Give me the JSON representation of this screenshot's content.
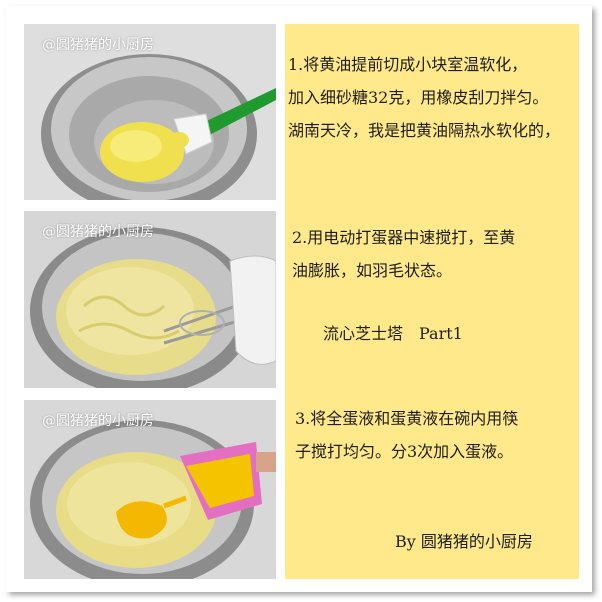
{
  "photos": [
    {
      "watermark": "@圆猪猪的小厨房"
    },
    {
      "watermark": "@圆猪猪的小厨房"
    },
    {
      "watermark": "@圆猪猪的小厨房"
    }
  ],
  "steps": [
    {
      "lines": [
        "1.将黄油提前切成小块室温软化，",
        "加入细砂糖32克，用橡皮刮刀拌匀。",
        "湖南天冷，我是把黄油隔热水软化的，"
      ]
    },
    {
      "lines": [
        "2.用电动打蛋器中速搅打，至黄",
        "油膨胀，如羽毛状态。"
      ]
    },
    {
      "lines": [
        "3.将全蛋液和蛋黄液在碗内用筷",
        "子搅打均匀。分3次加入蛋液。"
      ]
    }
  ],
  "title": "流心芝士塔　Part1",
  "signature": "By 圆猪猪的小厨房",
  "colors": {
    "panel": "#ffe98a",
    "butter": "#f2e45a",
    "bowl": "#b9b9b9",
    "spatula": "#1f9a2e",
    "cup": "#e46fc2",
    "egg": "#f5b800"
  }
}
